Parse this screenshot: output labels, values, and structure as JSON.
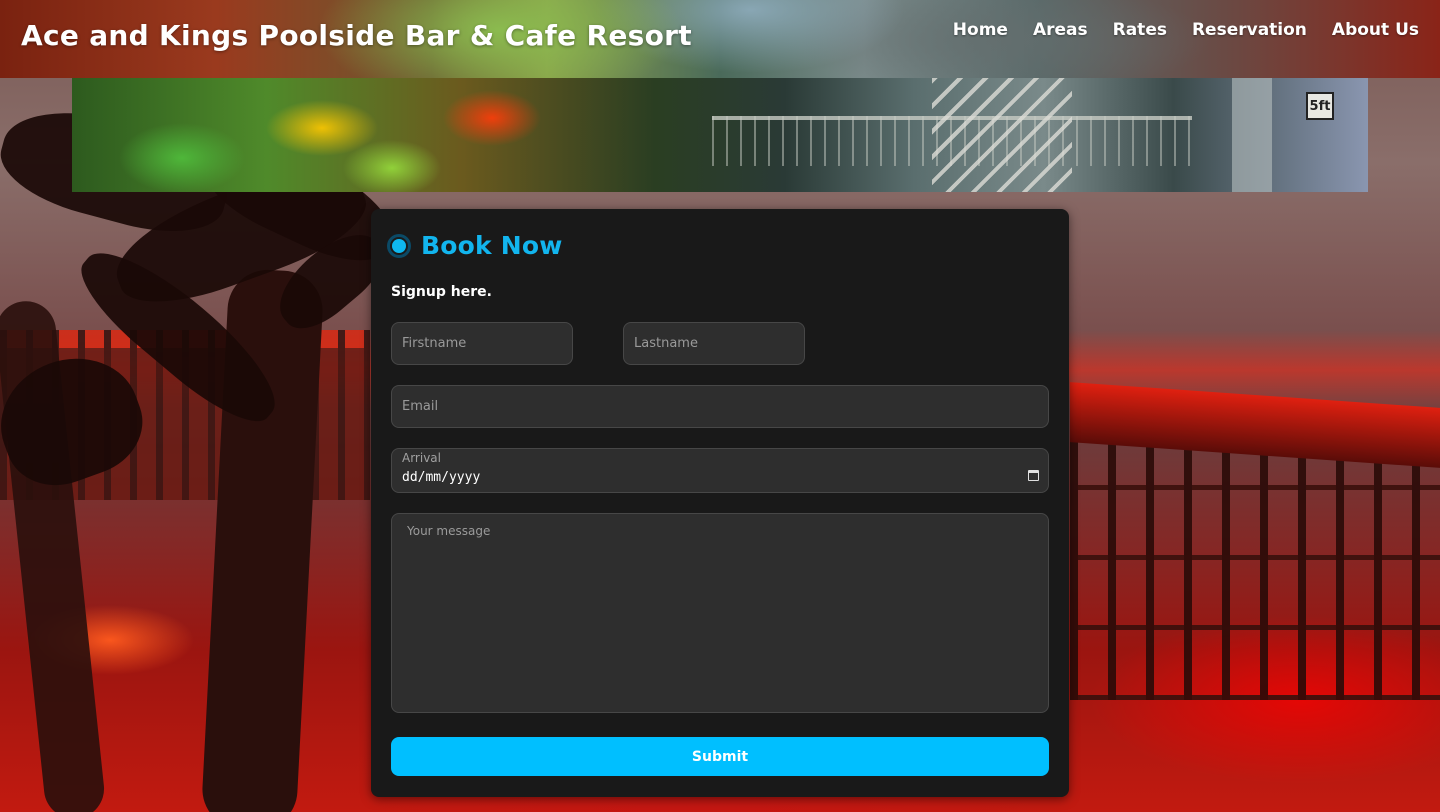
{
  "header": {
    "site_title": "Ace and Kings Poolside Bar & Cafe Resort",
    "nav": [
      "Home",
      "Areas",
      "Rates",
      "Reservation",
      "About Us"
    ]
  },
  "banner": {
    "sign_text": "5ft"
  },
  "form": {
    "title": "Book Now",
    "subtitle": "Signup here.",
    "firstname_placeholder": "Firstname",
    "lastname_placeholder": "Lastname",
    "email_placeholder": "Email",
    "arrival_label": "Arrival",
    "arrival_value": "dd/mm/yyyy",
    "message_placeholder": "Your message",
    "submit_label": "Submit"
  },
  "colors": {
    "accent": "#00bfff",
    "title": "#12b5ee",
    "card_bg": "#191919",
    "field_bg": "#2e2e2e"
  },
  "icons": {
    "title_icon": "dot-icon",
    "date_picker": "calendar-icon"
  }
}
